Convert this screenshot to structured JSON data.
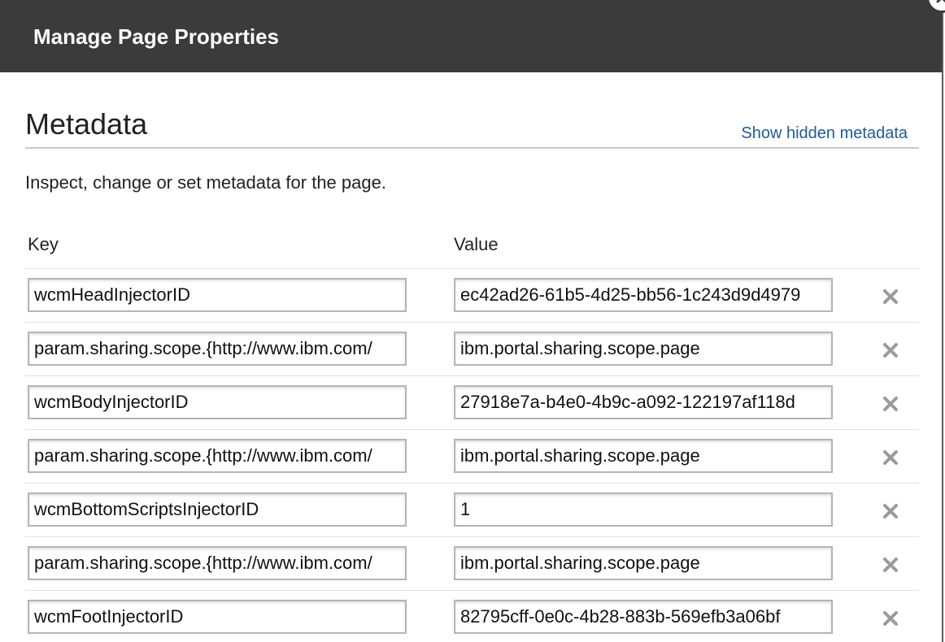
{
  "dialog": {
    "title": "Manage Page Properties",
    "close_icon": "close-circle-icon"
  },
  "section": {
    "title": "Metadata",
    "show_hidden_link": "Show hidden metadata",
    "description": "Inspect, change or set metadata for the page."
  },
  "table": {
    "key_header": "Key",
    "value_header": "Value",
    "remove_icon": "x-icon",
    "rows": [
      {
        "key": "wcmHeadInjectorID",
        "value": "ec42ad26-61b5-4d25-bb56-1c243d9d4979"
      },
      {
        "key": "param.sharing.scope.{http://www.ibm.com/",
        "value": "ibm.portal.sharing.scope.page"
      },
      {
        "key": "wcmBodyInjectorID",
        "value": "27918e7a-b4e0-4b9c-a092-122197af118d"
      },
      {
        "key": "param.sharing.scope.{http://www.ibm.com/",
        "value": "ibm.portal.sharing.scope.page"
      },
      {
        "key": "wcmBottomScriptsInjectorID",
        "value": "1"
      },
      {
        "key": "param.sharing.scope.{http://www.ibm.com/",
        "value": "ibm.portal.sharing.scope.page"
      },
      {
        "key": "wcmFootInjectorID",
        "value": "82795cff-0e0c-4b28-883b-569efb3a06bf"
      }
    ]
  },
  "colors": {
    "titlebar": "#3b3b3b",
    "link": "#1f5b96",
    "remove_icon": "#9a9a9a"
  }
}
